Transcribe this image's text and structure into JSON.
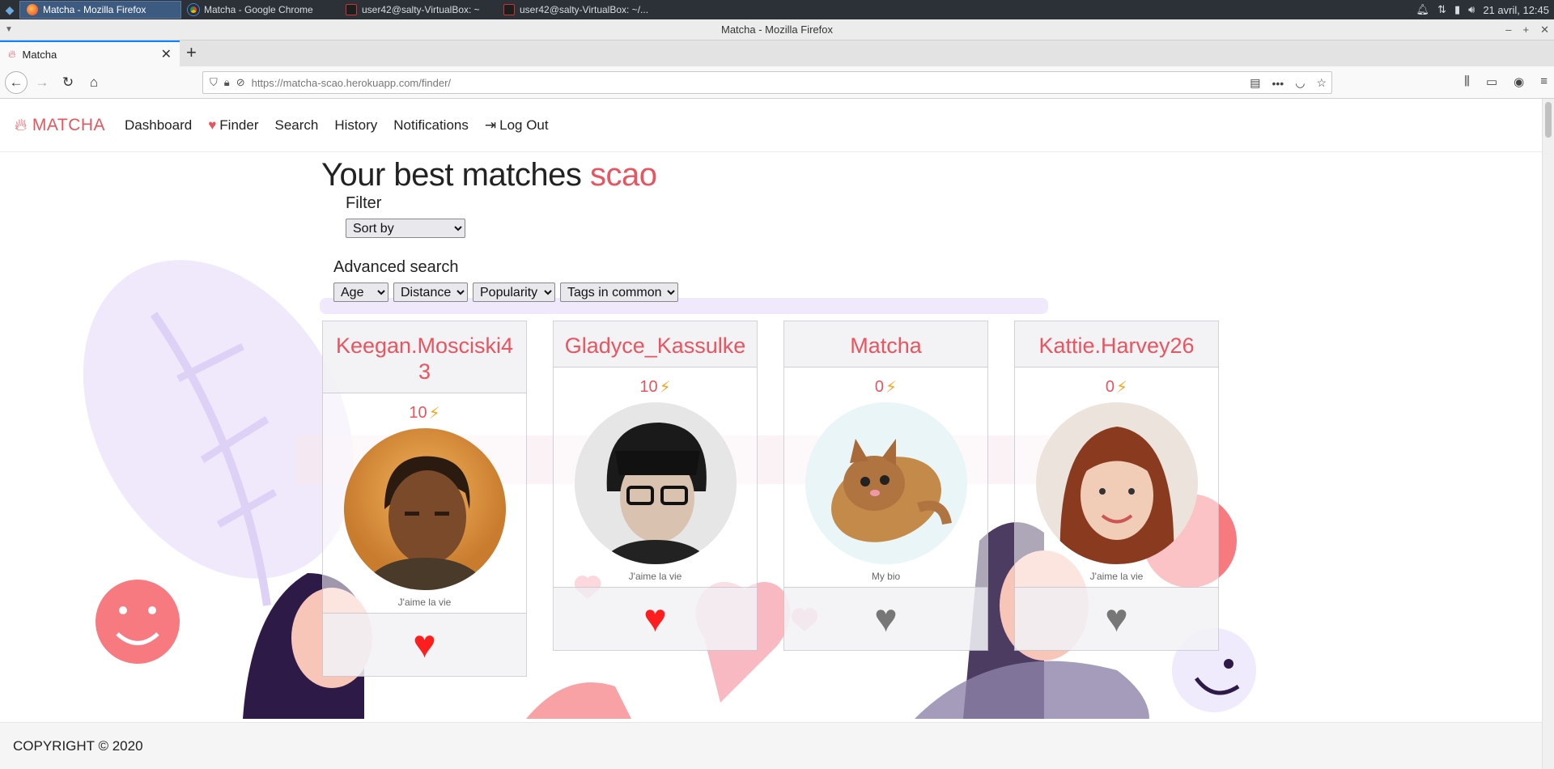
{
  "taskbar": {
    "tasks": [
      {
        "label": "Matcha - Mozilla Firefox",
        "icon": "firefox-icon"
      },
      {
        "label": "Matcha - Google Chrome",
        "icon": "chrome-icon"
      },
      {
        "label": "user42@salty-VirtualBox: ~",
        "icon": "terminal-icon"
      },
      {
        "label": "user42@salty-VirtualBox: ~/...",
        "icon": "terminal-icon"
      }
    ],
    "clock": "21 avril, 12:45"
  },
  "browser": {
    "window_title": "Matcha - Mozilla Firefox",
    "tab_title": "Matcha",
    "url_host": "https://matcha-scao.herokuapp.com",
    "url_path": "/finder/"
  },
  "site": {
    "brand": "MATCHA",
    "nav": {
      "dashboard": "Dashboard",
      "finder": "Finder",
      "search": "Search",
      "history": "History",
      "notifications": "Notifications",
      "logout": "Log Out"
    },
    "heading": "Your best matches",
    "username": "scao",
    "filter_label": "Filter",
    "sort_by": "Sort by",
    "advanced_label": "Advanced search",
    "advanced_selects": {
      "age": "Age",
      "distance": "Distance",
      "popularity": "Popularity",
      "tags": "Tags in common"
    },
    "footer": "COPYRIGHT © 2020",
    "accent": "#e8545f"
  },
  "cards": [
    {
      "username": "Keegan.Mosciski43",
      "score": "10",
      "bio": "J'aime la vie",
      "liked": true
    },
    {
      "username": "Gladyce_Kassulke",
      "score": "10",
      "bio": "J'aime la vie",
      "liked": true
    },
    {
      "username": "Matcha",
      "score": "0",
      "bio": "My bio",
      "liked": false
    },
    {
      "username": "Kattie.Harvey26",
      "score": "0",
      "bio": "J'aime la vie",
      "liked": false
    }
  ]
}
